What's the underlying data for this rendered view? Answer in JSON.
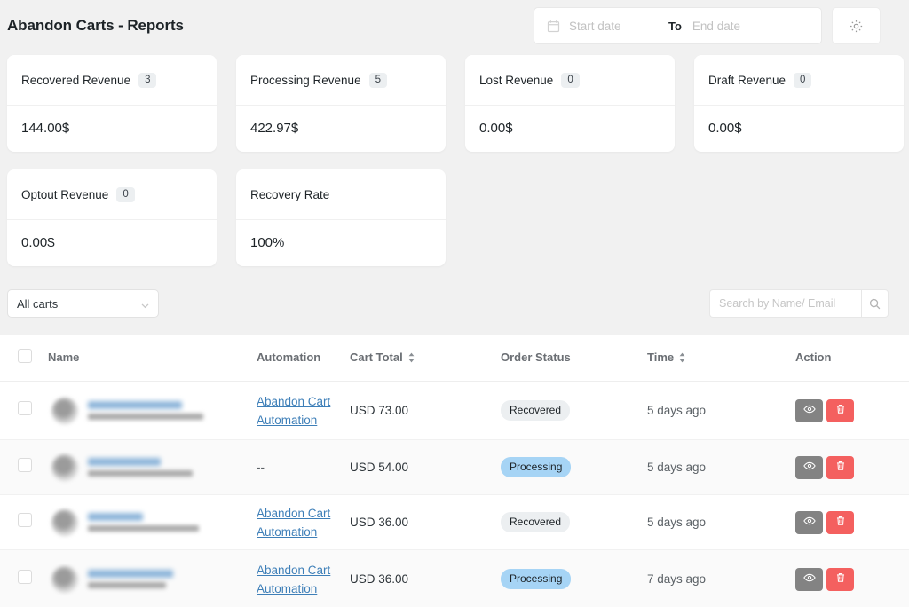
{
  "header": {
    "title": "Abandon Carts - Reports",
    "date_range": {
      "start_placeholder": "Start date",
      "start_value": "",
      "to_label": "To",
      "end_placeholder": "End date",
      "end_value": "",
      "calendar_icon": "calendar-icon"
    },
    "settings_icon": "gear-icon"
  },
  "stats": [
    {
      "label": "Recovered Revenue",
      "badge": "3",
      "value": "144.00$"
    },
    {
      "label": "Processing Revenue",
      "badge": "5",
      "value": "422.97$"
    },
    {
      "label": "Lost Revenue",
      "badge": "0",
      "value": "0.00$"
    },
    {
      "label": "Draft Revenue",
      "badge": "0",
      "value": "0.00$"
    },
    {
      "label": "Optout Revenue",
      "badge": "0",
      "value": "0.00$"
    },
    {
      "label": "Recovery Rate",
      "badge": "",
      "value": "100%"
    }
  ],
  "filters": {
    "cart_select": {
      "selected": "All carts",
      "options": [
        "All carts"
      ],
      "chevron_icon": "chevron-down-icon"
    },
    "search": {
      "placeholder": "Search by Name/ Email",
      "value": "",
      "icon": "search-icon"
    }
  },
  "table": {
    "columns": [
      {
        "key": "check",
        "label": "",
        "sortable": false
      },
      {
        "key": "name",
        "label": "Name",
        "sortable": false
      },
      {
        "key": "auto",
        "label": "Automation",
        "sortable": false
      },
      {
        "key": "total",
        "label": "Cart Total",
        "sortable": true
      },
      {
        "key": "status",
        "label": "Order Status",
        "sortable": false
      },
      {
        "key": "time",
        "label": "Time",
        "sortable": true
      },
      {
        "key": "action",
        "label": "Action",
        "sortable": false
      }
    ],
    "rows": [
      {
        "name": "",
        "email": "",
        "automation": "Abandon Cart Automation",
        "automation_is_link": true,
        "cart_total": "USD 73.00",
        "status": "Recovered",
        "status_kind": "recovered",
        "time": "5 days ago"
      },
      {
        "name": "",
        "email": "",
        "automation": "--",
        "automation_is_link": false,
        "cart_total": "USD 54.00",
        "status": "Processing",
        "status_kind": "processing",
        "time": "5 days ago"
      },
      {
        "name": "",
        "email": "",
        "automation": "Abandon Cart Automation",
        "automation_is_link": true,
        "cart_total": "USD 36.00",
        "status": "Recovered",
        "status_kind": "recovered",
        "time": "5 days ago"
      },
      {
        "name": "",
        "email": "",
        "automation": "Abandon Cart Automation",
        "automation_is_link": true,
        "cart_total": "USD 36.00",
        "status": "Processing",
        "status_kind": "processing",
        "time": "7 days ago"
      }
    ],
    "row_actions": {
      "view_icon": "eye-icon",
      "delete_icon": "trash-icon"
    }
  },
  "colors": {
    "page_background": "#f1f1f1",
    "card_background": "#ffffff",
    "link": "#3e7fb8",
    "badge_processing": "#a6d4f5",
    "badge_recovered": "#eceff1",
    "action_view": "#838383",
    "action_delete": "#f4605f"
  }
}
